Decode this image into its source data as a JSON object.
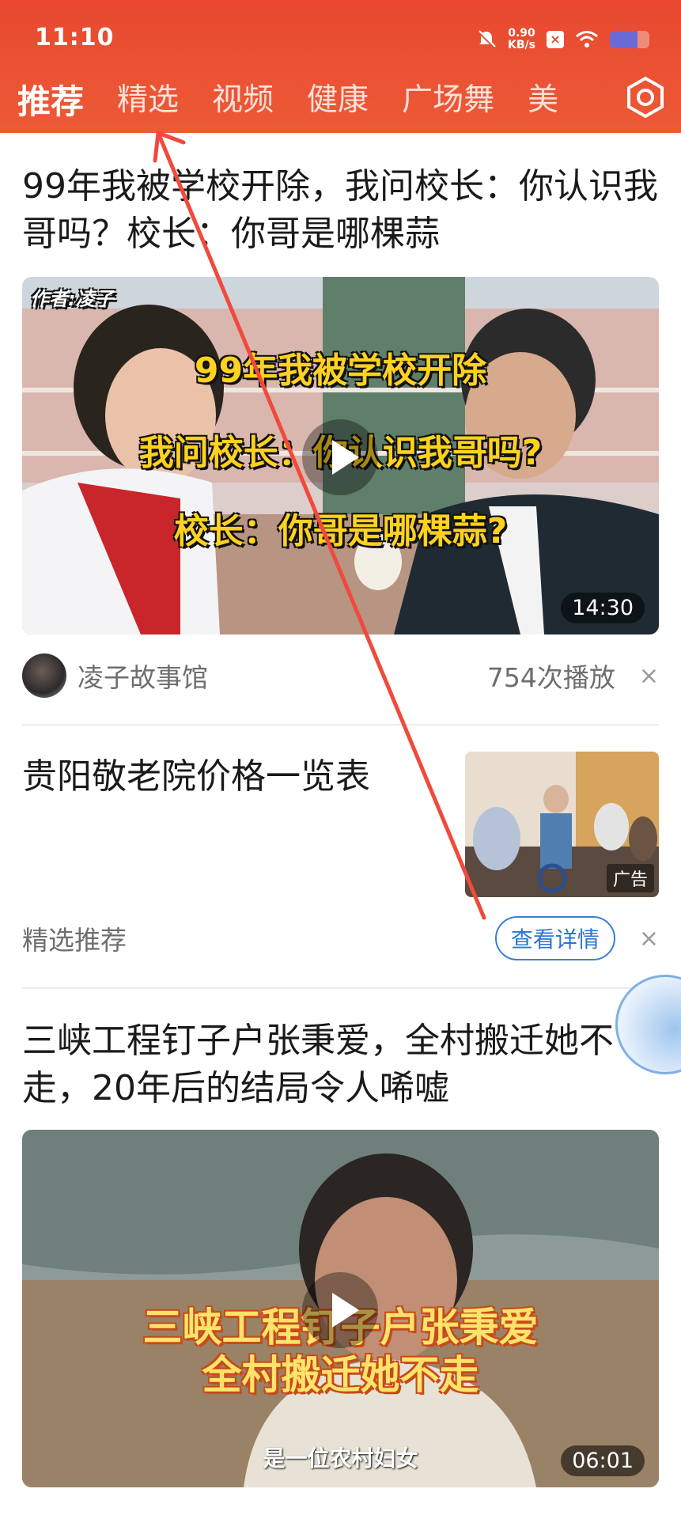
{
  "status_bar": {
    "time": "11:10",
    "speed": "0.90",
    "speed_unit": "KB/s",
    "battery_level": 0.7
  },
  "tabs": [
    {
      "label": "推荐",
      "active": true
    },
    {
      "label": "精选"
    },
    {
      "label": "视频"
    },
    {
      "label": "健康"
    },
    {
      "label": "广场舞"
    },
    {
      "label": "美"
    }
  ],
  "feed": [
    {
      "title": "99年我被学校开除，我问校长：你认识我哥吗？校长：你哥是哪棵蒜",
      "watermark": "作者:凌子",
      "captions": [
        "99年我被学校开除",
        "我问校长：你认识我哥吗?",
        "校长：你哥是哪棵蒜?"
      ],
      "duration": "14:30",
      "author": "凌子故事馆",
      "plays": "754次播放"
    },
    {
      "title": "贵阳敬老院价格一览表",
      "ad_label": "广告",
      "source": "精选推荐",
      "button": "查看详情"
    },
    {
      "title": "三峡工程钉子户张秉爱，全村搬迁她不走，20年后的结局令人唏嘘",
      "captions": [
        "三峡工程钉子户张秉爱",
        "全村搬迁她不走"
      ],
      "subtitle": "是一位农村妇女",
      "duration": "06:01"
    }
  ],
  "icons": {
    "close": "×",
    "settings": "hexagon-settings-icon"
  },
  "colors": {
    "header": "#e8482f",
    "accent_blue": "#2f74d0"
  }
}
